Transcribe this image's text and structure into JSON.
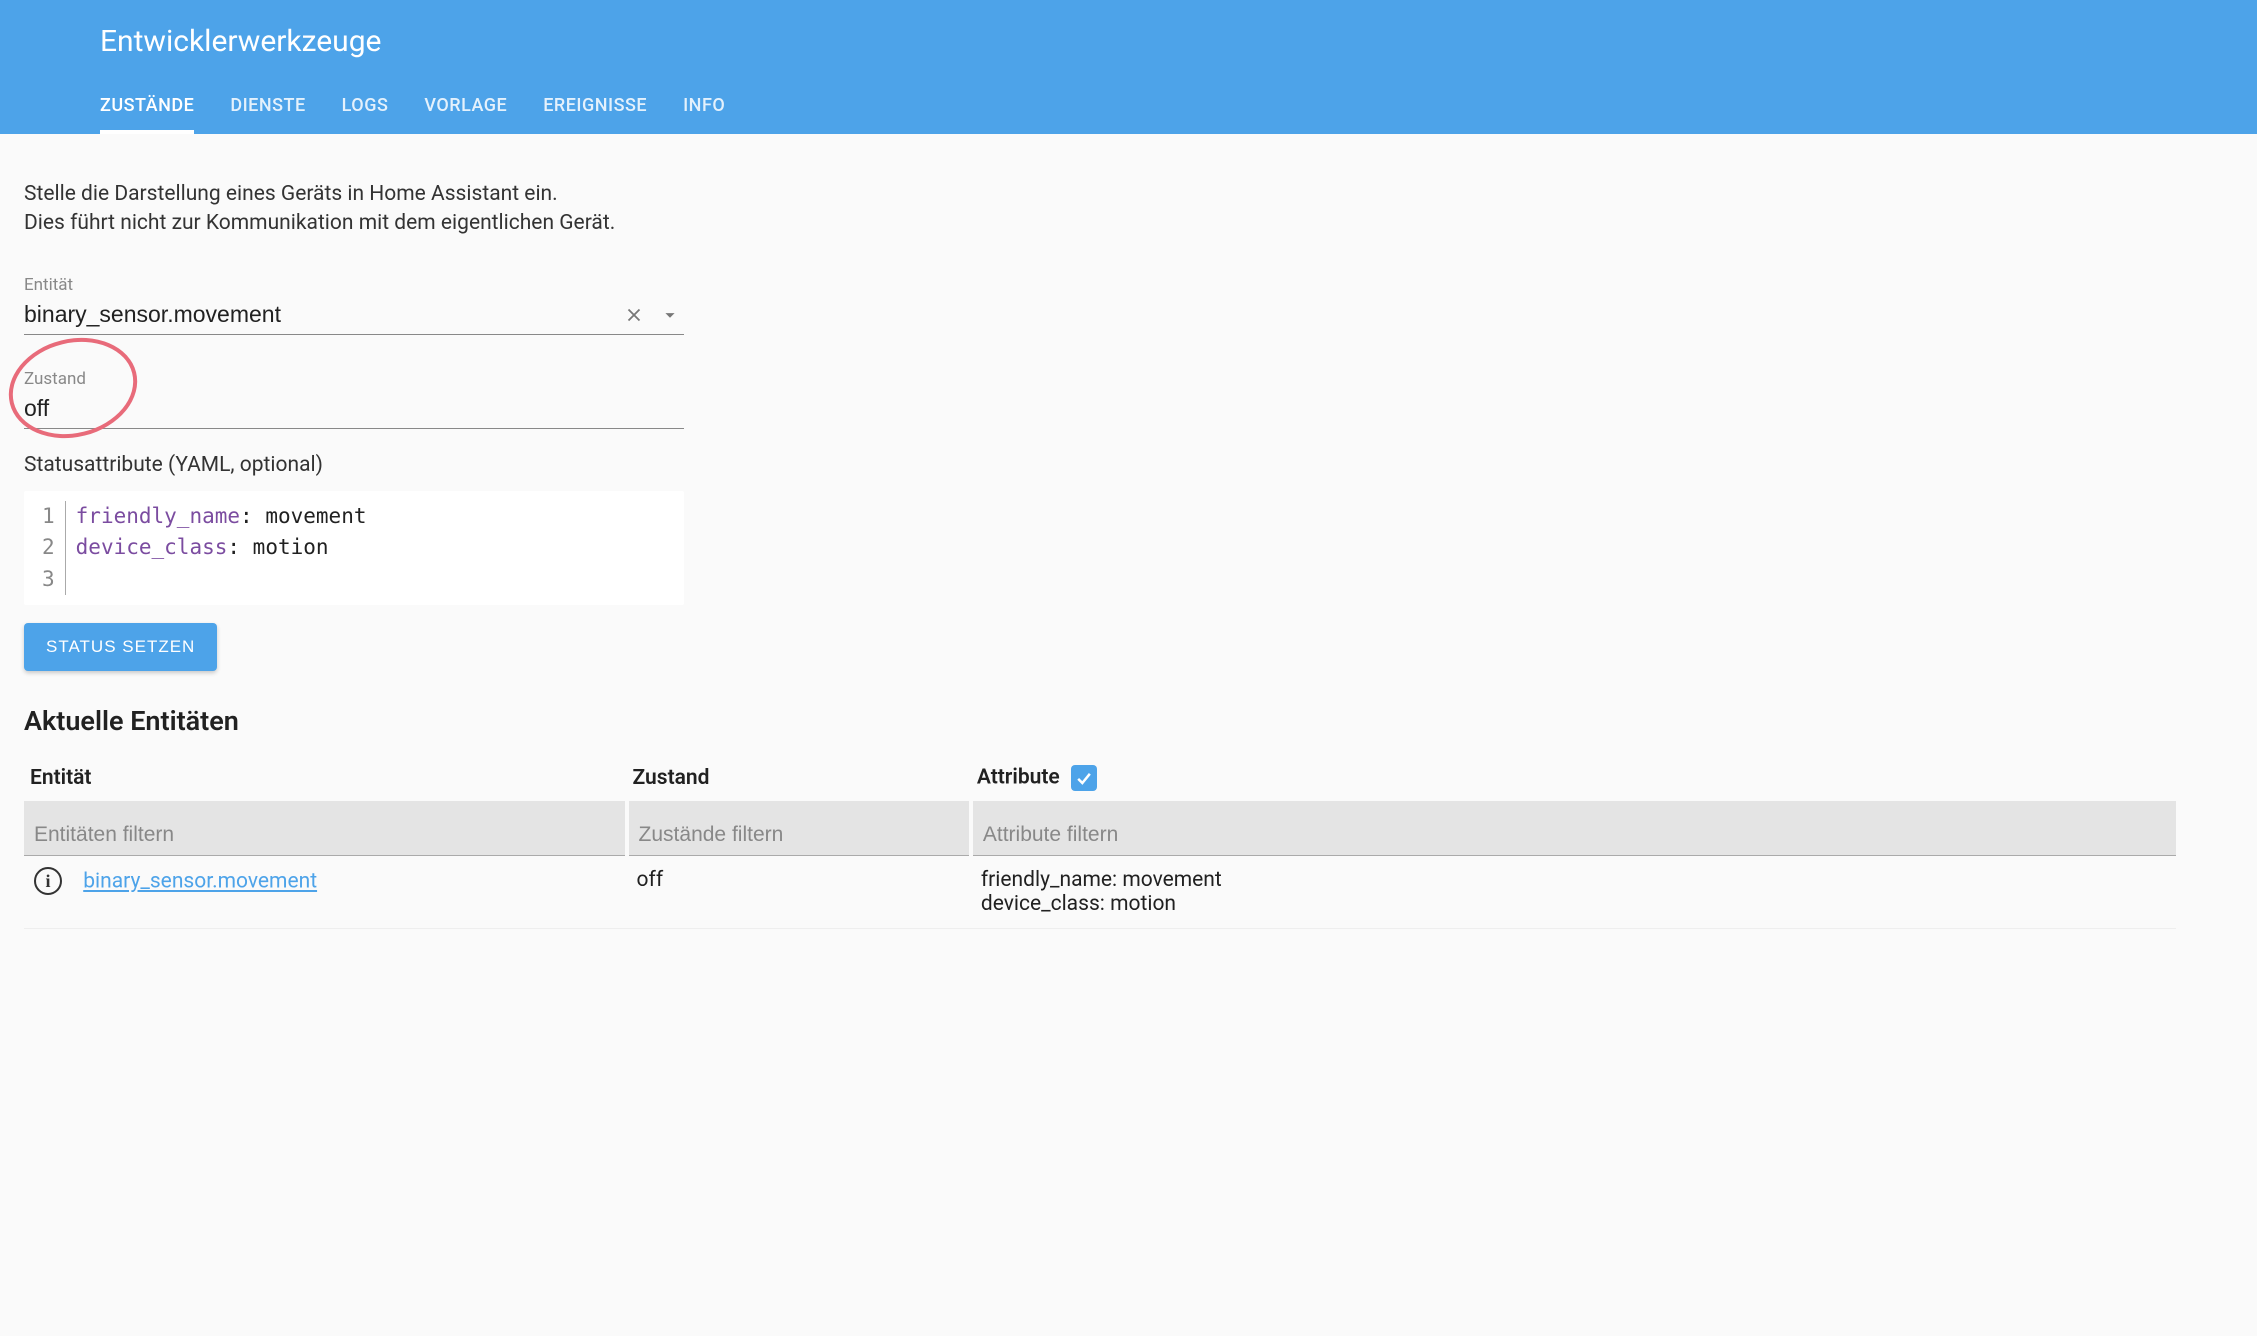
{
  "header": {
    "title": "Entwicklerwerkzeuge",
    "tabs": [
      "ZUSTÄNDE",
      "DIENSTE",
      "LOGS",
      "VORLAGE",
      "EREIGNISSE",
      "INFO"
    ],
    "active_tab_index": 0
  },
  "intro": {
    "line1": "Stelle die Darstellung eines Geräts in Home Assistant ein.",
    "line2": "Dies führt nicht zur Kommunikation mit dem eigentlichen Gerät."
  },
  "form": {
    "entity_label": "Entität",
    "entity_value": "binary_sensor.movement",
    "state_label": "Zustand",
    "state_value": "off",
    "attrs_label": "Statusattribute (YAML, optional)",
    "yaml": {
      "line1_key": "friendly_name",
      "line1_val": " movement",
      "line2_key": "device_class",
      "line2_val": " motion"
    },
    "set_button": "STATUS SETZEN"
  },
  "entities": {
    "section_title": "Aktuelle Entitäten",
    "headers": {
      "entity": "Entität",
      "state": "Zustand",
      "attributes": "Attribute"
    },
    "filters": {
      "entity_placeholder": "Entitäten filtern",
      "state_placeholder": "Zustände filtern",
      "attribute_placeholder": "Attribute filtern"
    },
    "row": {
      "entity_id": "binary_sensor.movement",
      "state": "off",
      "attr_line1": "friendly_name: movement",
      "attr_line2": "device_class: motion"
    }
  }
}
